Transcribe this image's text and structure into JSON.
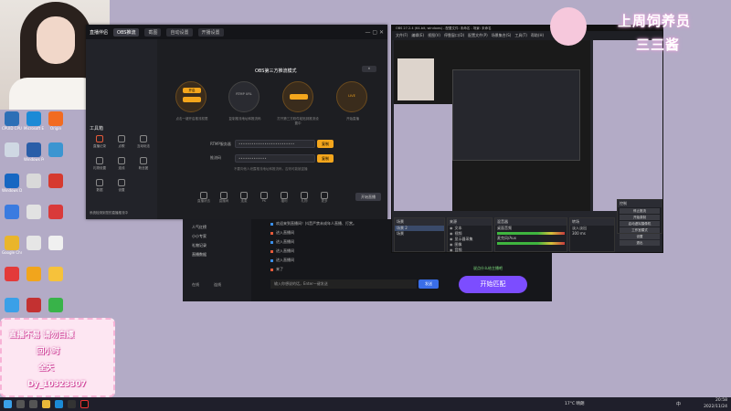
{
  "desktop_icons": [
    {
      "label": "CPUID CPU-Z",
      "color": "#2d6fb6"
    },
    {
      "label": "Microsoft Edge",
      "color": "#1b8ad6"
    },
    {
      "label": "Origin",
      "color": "#f26b21"
    },
    {
      "label": "",
      "color": "#cfd8e3"
    },
    {
      "label": "Windows PowerShell",
      "color": "#2a5ea8"
    },
    {
      "label": "",
      "color": "#3b95d1"
    },
    {
      "label": "Windows Defender",
      "color": "#1767c2"
    },
    {
      "label": "",
      "color": "#d9d9d9"
    },
    {
      "label": "",
      "color": "#d63a2f"
    },
    {
      "label": "",
      "color": "#3a7be0"
    },
    {
      "label": "",
      "color": "#e2e2e2"
    },
    {
      "label": "",
      "color": "#d93a3a"
    },
    {
      "label": "Google Chrome",
      "color": "#e9b52b"
    },
    {
      "label": "",
      "color": "#e6e6e6"
    },
    {
      "label": "",
      "color": "#f0f0f0"
    },
    {
      "label": "",
      "color": "#e33a3a"
    },
    {
      "label": "",
      "color": "#f1a51c"
    },
    {
      "label": "",
      "color": "#f6c23b"
    },
    {
      "label": "",
      "color": "#3aa0e8"
    },
    {
      "label": "",
      "color": "#c33131"
    },
    {
      "label": "",
      "color": "#38b349"
    },
    {
      "label": "",
      "color": "#222"
    },
    {
      "label": "",
      "color": "#1f8a2c"
    },
    {
      "label": "",
      "color": "#2d2d2d"
    }
  ],
  "obs_companion": {
    "brand": "直播伴侣",
    "top_tabs": [
      "OBS推流",
      "截图",
      "自动设置",
      "开播设置"
    ],
    "guide_title": "OBS第三方推流模式",
    "steps": [
      {
        "btn": "开启",
        "desc": "点击一键开启推流权限"
      },
      {
        "btn": "",
        "desc": "复制推流地址和推流码"
      },
      {
        "btn": "",
        "desc": "打开第三方软件粘贴到推流设置中"
      },
      {
        "btn": "",
        "desc": "开始直播"
      }
    ],
    "server_label": "RTMP服务器",
    "key_label": "推流码",
    "copy_label": "复制",
    "note": "不要向他人泄露推流地址和推流码，否则可能被盗播",
    "sidebar_title": "工具箱",
    "tools": [
      "直播记录",
      "点歌",
      "互动玩法",
      "礼物设置",
      "连线",
      "粉丝团",
      "数据",
      "设置"
    ],
    "toolbar": [
      "直播状态",
      "直播间",
      "连麦",
      "PK",
      "福利",
      "礼物",
      "更多"
    ],
    "start_btn": "开始直播",
    "status": "系统检测到您的直播推流中"
  },
  "chat": {
    "left_items": [
      "人气红榜",
      "小小专家",
      "礼物记录",
      "直播数据"
    ],
    "left_status": [
      "在线",
      "连线"
    ],
    "lines": [
      "欢迎来到直播间！抖音严禁未成年人直播、打赏。",
      "进入直播间",
      "进入直播间",
      "进入直播间",
      "进入直播间",
      "来了",
      "进入直播间",
      "进入直播间"
    ],
    "input_placeholder": "输入你想说的话，Enter一键发送",
    "send_label": "发送",
    "match_label": "开始匹配",
    "banner": "说点什么给主播吧"
  },
  "obs": {
    "title": "OBS 27.2.4 (64-bit, windows) - 配置文件: 未命名 - 场景: 未命名",
    "menus": [
      "文件(F)",
      "编辑(E)",
      "视图(V)",
      "停靠窗口(D)",
      "配置文件(P)",
      "场景集合(S)",
      "工具(T)",
      "帮助(H)"
    ],
    "docks": {
      "scenes": {
        "title": "场景",
        "items": [
          "场景 2",
          "场景"
        ]
      },
      "sources": {
        "title": "来源",
        "items": [
          "文本",
          "视频",
          "显示器采集",
          "图像",
          "音频"
        ]
      },
      "mixer": {
        "title": "混音器",
        "items": [
          "桌面音频",
          "麦克风/Aux"
        ]
      },
      "transitions": {
        "title": "转场",
        "items": [
          "淡入淡出",
          "300 ms"
        ]
      },
      "controls": {
        "title": "控制",
        "buttons": [
          "停止推流",
          "开始录制",
          "启动虚拟摄像机",
          "工作室模式",
          "设置",
          "退出"
        ]
      }
    }
  },
  "sticker": {
    "line1": "上周饲养员",
    "line2": "三三酱"
  },
  "info_card": {
    "line1": "直播不易 请勿白嫖",
    "line2": "回小时",
    "line3": "全天",
    "line4": "Dy_10323307"
  },
  "taskbar": {
    "weather": "17°C 晴朗",
    "time": "20:58",
    "date": "2022/11/24",
    "lang": "中"
  }
}
